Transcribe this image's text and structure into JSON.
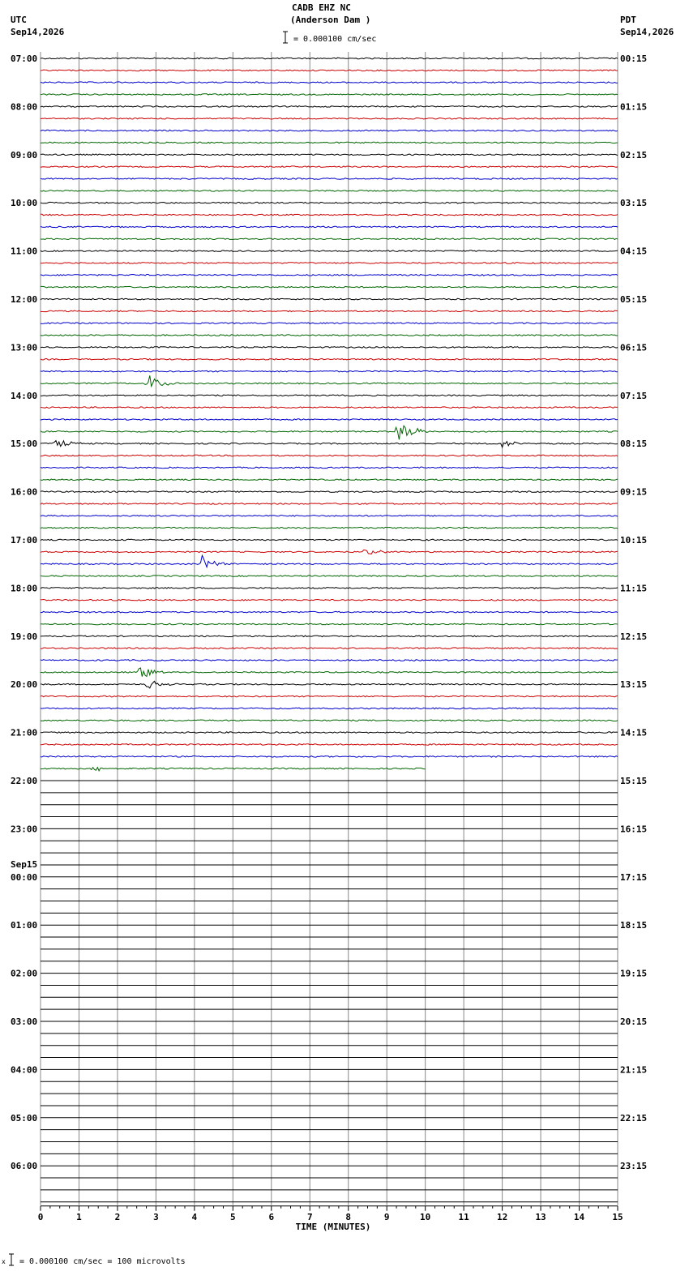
{
  "header": {
    "station": "CADB EHZ NC",
    "site": "(Anderson Dam )",
    "scale": "= 0.000100 cm/sec",
    "left_tz": "UTC",
    "left_date": "Sep14,2026",
    "right_tz": "PDT",
    "right_date": "Sep14,2026",
    "date_change_label": "Sep15"
  },
  "footer": {
    "calibration": "= 0.000100 cm/sec =     100 microvolts",
    "marker": "x"
  },
  "chart_data": {
    "type": "line",
    "description_free": true,
    "xlabel": "TIME (MINUTES)",
    "xlim": [
      0,
      15
    ],
    "x_ticks": [
      "0",
      "1",
      "2",
      "3",
      "4",
      "5",
      "6",
      "7",
      "8",
      "9",
      "10",
      "11",
      "12",
      "13",
      "14",
      "15"
    ],
    "trace_colors": [
      "#000000",
      "#cc0000",
      "#0000cc",
      "#006600"
    ],
    "rows_per_hour": 4,
    "total_rows": 96,
    "recorded_rows": 60,
    "last_row_minutes": 10,
    "utc_hour_labels": [
      "07:00",
      "08:00",
      "09:00",
      "10:00",
      "11:00",
      "12:00",
      "13:00",
      "14:00",
      "15:00",
      "16:00",
      "17:00",
      "18:00",
      "19:00",
      "20:00",
      "21:00",
      "22:00",
      "23:00",
      "00:00",
      "01:00",
      "02:00",
      "03:00",
      "04:00",
      "05:00",
      "06:00"
    ],
    "pdt_hour_labels": [
      "00:15",
      "01:15",
      "02:15",
      "03:15",
      "04:15",
      "05:15",
      "06:15",
      "07:15",
      "08:15",
      "09:15",
      "10:15",
      "11:15",
      "12:15",
      "13:15",
      "14:15",
      "15:15",
      "16:15",
      "17:15",
      "18:15",
      "19:15",
      "20:15",
      "21:15",
      "22:15",
      "23:15"
    ],
    "events": [
      {
        "row": 27,
        "minute": 2.8,
        "amplitude": 0.6
      },
      {
        "row": 31,
        "minute": 9.3,
        "amplitude": 1.0
      },
      {
        "row": 32,
        "minute": 0.4,
        "amplitude": 0.35
      },
      {
        "row": 32,
        "minute": 12.0,
        "amplitude": 0.3
      },
      {
        "row": 41,
        "minute": 8.4,
        "amplitude": 0.3
      },
      {
        "row": 42,
        "minute": 4.2,
        "amplitude": 0.6
      },
      {
        "row": 51,
        "minute": 2.6,
        "amplitude": 0.5
      },
      {
        "row": 52,
        "minute": 2.8,
        "amplitude": 0.4
      },
      {
        "row": 59,
        "minute": 1.4,
        "amplitude": 0.25
      }
    ]
  }
}
